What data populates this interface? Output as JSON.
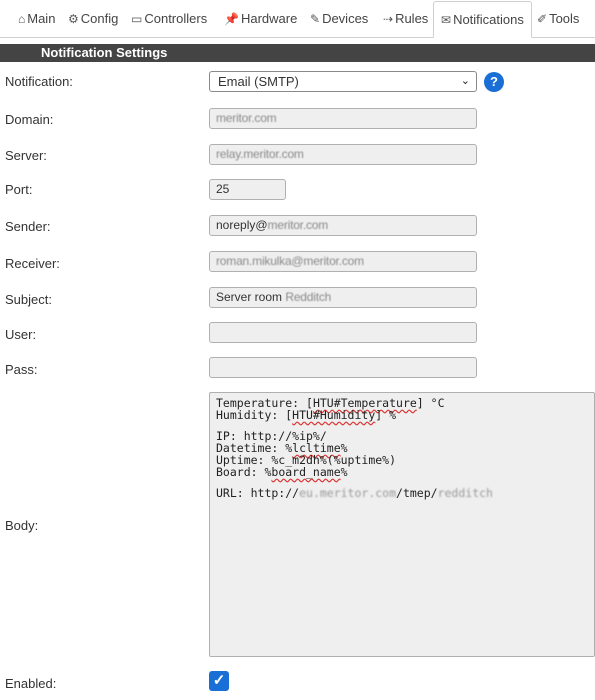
{
  "tabs": [
    {
      "icon": "⌂",
      "label": "Main"
    },
    {
      "icon": "⚙",
      "label": "Config"
    },
    {
      "icon": "▭",
      "label": "Controllers"
    },
    {
      "icon": "📌",
      "label": "Hardware"
    },
    {
      "icon": "✎",
      "label": "Devices"
    },
    {
      "icon": "⇢",
      "label": "Rules"
    },
    {
      "icon": "✉",
      "label": "Notifications"
    },
    {
      "icon": "✐",
      "label": "Tools"
    }
  ],
  "active_tab": "Notifications",
  "section_title": "Notification Settings",
  "form": {
    "notification_label": "Notification:",
    "notification_value": "Email (SMTP)",
    "help_label": "?",
    "domain_label": "Domain:",
    "domain_value": "meritor.com",
    "server_label": "Server:",
    "server_value": "relay.meritor.com",
    "port_label": "Port:",
    "port_value": "25",
    "sender_label": "Sender:",
    "sender_value_prefix": "noreply@",
    "sender_value_blurred": "meritor.com",
    "receiver_label": "Receiver:",
    "receiver_value": "roman.mikulka@meritor.com",
    "subject_label": "Subject:",
    "subject_value_prefix": "Server room ",
    "subject_value_blurred": "Redditch",
    "user_label": "User:",
    "user_value": "",
    "pass_label": "Pass:",
    "pass_value": "",
    "body_label": "Body:",
    "body": {
      "line1_a": "Temperature: [",
      "line1_b": "HTU#Temperature",
      "line1_c": "] °C",
      "line2_a": "Humidity: [",
      "line2_b": "HTU#Humidity",
      "line2_c": "] %",
      "line3": "IP: http://%ip%/",
      "line4_a": "Datetime: %",
      "line4_b": "lcltime",
      "line4_c": "%",
      "line5": "Uptime: %c_m2dh%(%uptime%)",
      "line6_a": "Board: %",
      "line6_b": "board_name",
      "line6_c": "%",
      "line7_a": "URL: http://",
      "line7_b": "eu.meritor.com",
      "line7_c": "/tmep/",
      "line7_d": "redditch"
    },
    "enabled_label": "Enabled:",
    "enabled_checked": true,
    "check_glyph": "✓"
  }
}
